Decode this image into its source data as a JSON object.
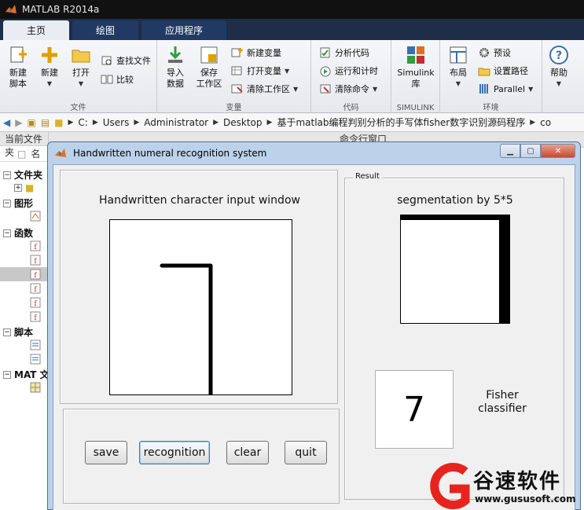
{
  "matlab": {
    "title": "MATLAB R2014a",
    "tabs": [
      {
        "label": "主页",
        "active": true
      },
      {
        "label": "绘图",
        "active": false
      },
      {
        "label": "应用程序",
        "active": false
      }
    ],
    "ribbon": {
      "file": {
        "section_label": "文件",
        "new_script": "新建\n脚本",
        "new": "新建",
        "open": "打开",
        "find_files": "查找文件",
        "compare": "比较"
      },
      "variable": {
        "section_label": "变量",
        "import_data": "导入\n数据",
        "save_workspace": "保存\n工作区",
        "new_variable": "新建变量",
        "open_variable": "打开变量",
        "clear_workspace": "清除工作区"
      },
      "code": {
        "section_label": "代码",
        "analyze": "分析代码",
        "run_time": "运行和计时",
        "clear_commands": "清除命令"
      },
      "simulink": {
        "section_label": "SIMULINK",
        "library": "Simulink\n库"
      },
      "environment": {
        "section_label": "环境",
        "layout": "布局",
        "preferences": "预设",
        "set_path": "设置路径",
        "parallel": "Parallel"
      },
      "resources": {
        "help": "帮助"
      }
    },
    "address": [
      "C:",
      "Users",
      "Administrator",
      "Desktop",
      "基于matlab编程判别分析的手写体fisher数字识别源码程序",
      "co"
    ],
    "left_panel": {
      "header": "当前文件夹",
      "col_name": "名",
      "groups": [
        {
          "label": "文件夹"
        },
        {
          "label": "图形"
        },
        {
          "label": "函数"
        },
        {
          "label": "脚本"
        },
        {
          "label": "MAT 文"
        }
      ]
    },
    "command_window": "命令行窗口"
  },
  "figure": {
    "title": "Handwritten numeral recognition system",
    "input_label": "Handwritten character input window",
    "result_legend": "Result",
    "segmentation_label": "segmentation by 5*5",
    "result_digit": "7",
    "classifier_label": "Fisher classifier",
    "buttons": {
      "save": "save",
      "recognition": "recognition",
      "clear": "clear",
      "quit": "quit"
    }
  },
  "watermark": {
    "brand": "谷速软件",
    "url": "www.gususoft.com",
    "color": "#e8231d"
  }
}
